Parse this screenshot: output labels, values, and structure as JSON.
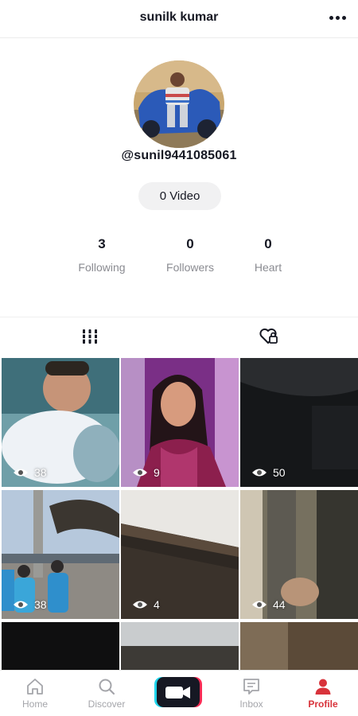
{
  "header": {
    "title": "sunilk kumar"
  },
  "profile": {
    "username": "@sunil9441085061",
    "video_button": "0 Video"
  },
  "stats": [
    {
      "value": "3",
      "label": "Following"
    },
    {
      "value": "0",
      "label": "Followers"
    },
    {
      "value": "0",
      "label": "Heart"
    }
  ],
  "tabs": [
    {
      "icon": "grid-icon"
    },
    {
      "icon": "liked-heart-icon"
    }
  ],
  "videos": [
    {
      "views": "38"
    },
    {
      "views": "9"
    },
    {
      "views": "50"
    },
    {
      "views": "38"
    },
    {
      "views": "4"
    },
    {
      "views": "44"
    }
  ],
  "nav": [
    {
      "label": "Home",
      "icon": "home-icon"
    },
    {
      "label": "Discover",
      "icon": "search-icon"
    },
    {
      "label": "",
      "icon": "video-camera-icon"
    },
    {
      "label": "Inbox",
      "icon": "message-icon"
    },
    {
      "label": "Profile",
      "icon": "person-icon"
    }
  ],
  "colors": {
    "accent": "#d8333b",
    "create_left": "#20d5ec",
    "create_right": "#fe2c55"
  }
}
